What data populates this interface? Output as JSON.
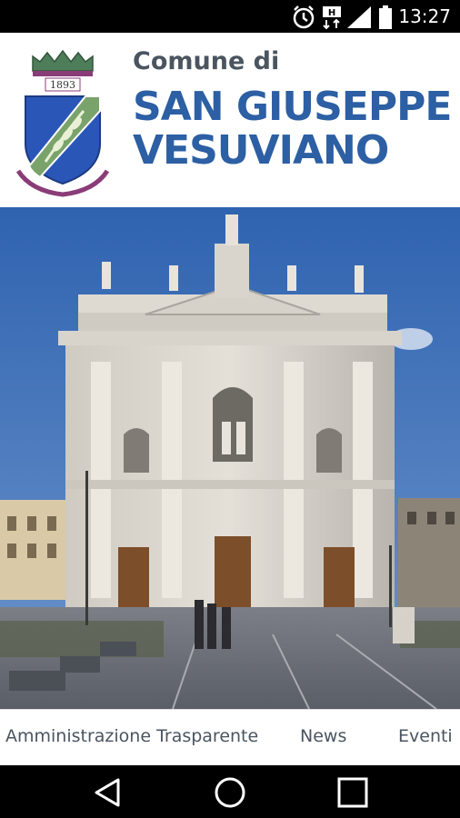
{
  "status_bar": {
    "time": "13:27",
    "icons": [
      "alarm-icon",
      "data-transfer-icon",
      "signal-icon",
      "battery-icon"
    ]
  },
  "header": {
    "crest_year": "1893",
    "prefix": "Comune di",
    "city_line1": "SAN GIUSEPPE",
    "city_line2": "VESUVIANO"
  },
  "photo": {
    "subject": "church-facade"
  },
  "bottom_nav": {
    "items": [
      {
        "label": "Amministrazione Trasparente"
      },
      {
        "label": "News"
      },
      {
        "label": "Eventi"
      }
    ]
  },
  "system_nav": {
    "icons": [
      "back-icon",
      "home-icon",
      "recents-icon"
    ]
  },
  "colors": {
    "brand_blue": "#2c5fa3",
    "text_gray": "#4a5560",
    "sky": "#3d6fb8"
  }
}
